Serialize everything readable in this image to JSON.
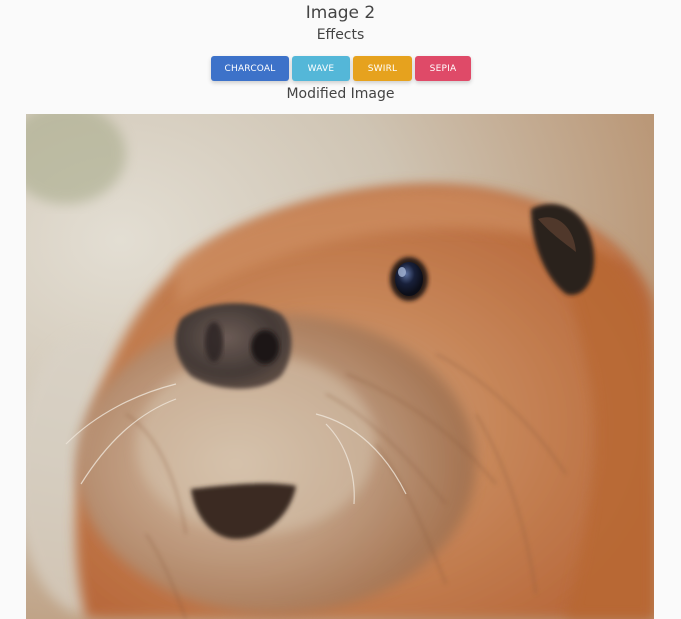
{
  "header": {
    "title": "Image 2",
    "effects_label": "Effects"
  },
  "effects": {
    "buttons": [
      {
        "label": "CHARCOAL",
        "color": "#3d72c9"
      },
      {
        "label": "WAVE",
        "color": "#54b7d8"
      },
      {
        "label": "SWIRL",
        "color": "#e6a21e"
      },
      {
        "label": "SEPIA",
        "color": "#df4a68"
      }
    ]
  },
  "image_section": {
    "label": "Modified Image",
    "image_subject": "beaver-closeup"
  }
}
